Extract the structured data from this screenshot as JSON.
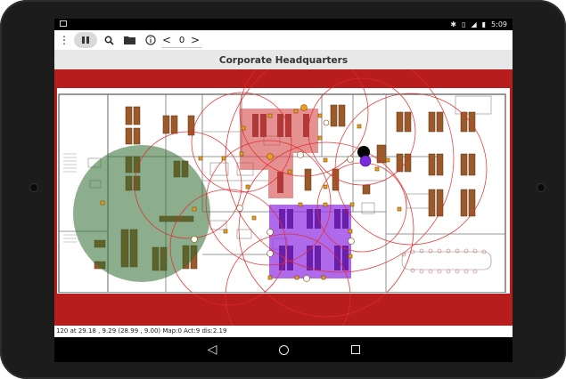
{
  "statusbar": {
    "bluetooth_icon": "bluetooth-icon",
    "vibrate_icon": "vibrate-icon",
    "signal_icon": "signal-icon",
    "battery_icon": "battery-icon",
    "time": "5:09"
  },
  "toolbar": {
    "menu_icon": "more-vert-icon",
    "pause_icon": "pause-icon",
    "search_icon": "search-icon",
    "folder_icon": "folder-icon",
    "info_icon": "info-icon",
    "prev_glyph": "<",
    "counter": "0",
    "next_glyph": ">"
  },
  "title": "Corporate Headquarters",
  "footer_text": "120 at 29.18 , 9.29 (28.99 , 9.00)  Map:0 Act:9 dis:2.19",
  "navbar": {
    "back_glyph": "◁",
    "home_icon": "home-icon",
    "recent_icon": "recent-apps-icon"
  },
  "colors": {
    "map_border": "#b71d1d",
    "zone_green": "#2e6b2e",
    "zone_red": "#d44848",
    "zone_purple": "#8b2be2",
    "beacon_orange": "#e8a020",
    "range_circle": "#e12a2a"
  }
}
